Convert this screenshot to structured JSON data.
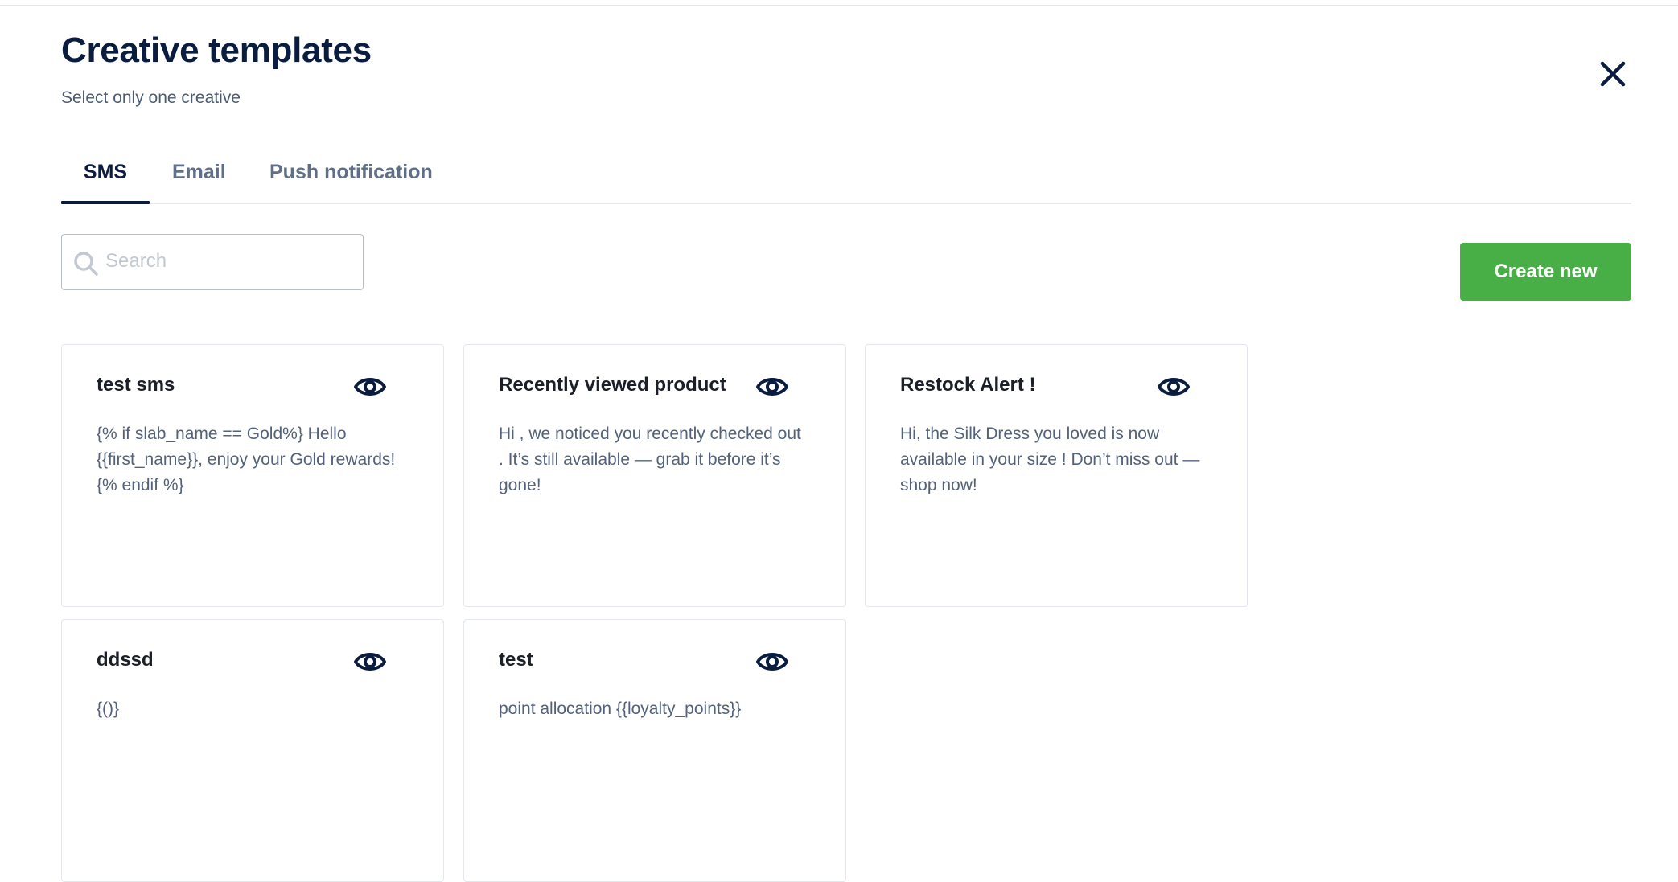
{
  "header": {
    "title": "Creative templates",
    "subtitle": "Select only one creative"
  },
  "tabs": [
    {
      "label": "SMS",
      "active": true
    },
    {
      "label": "Email",
      "active": false
    },
    {
      "label": "Push notification",
      "active": false
    }
  ],
  "search": {
    "placeholder": "Search",
    "value": ""
  },
  "actions": {
    "create_label": "Create new"
  },
  "cards": [
    {
      "title": "test sms",
      "body": "{% if slab_name == Gold%} Hello\n{{first_name}}, enjoy your Gold rewards!\n{% endif %}"
    },
    {
      "title": "Recently viewed product",
      "body": "Hi , we noticed you recently checked out\n. It’s still available — grab it before it’s\ngone!"
    },
    {
      "title": "Restock Alert !",
      "body": "Hi, the Silk Dress you loved is now\navailable in your size ! Don’t miss out —\nshop now!"
    },
    {
      "title": "ddssd",
      "body": "{()}"
    },
    {
      "title": "test",
      "body": "point allocation {{loyalty_points}}"
    }
  ],
  "icons": {
    "close": "close-icon",
    "search": "search-icon",
    "preview": "eye-icon"
  },
  "colors": {
    "primary_text": "#0b1d3f",
    "accent_green": "#47af46",
    "muted_text": "#53627a",
    "border": "#e4e7ec"
  }
}
